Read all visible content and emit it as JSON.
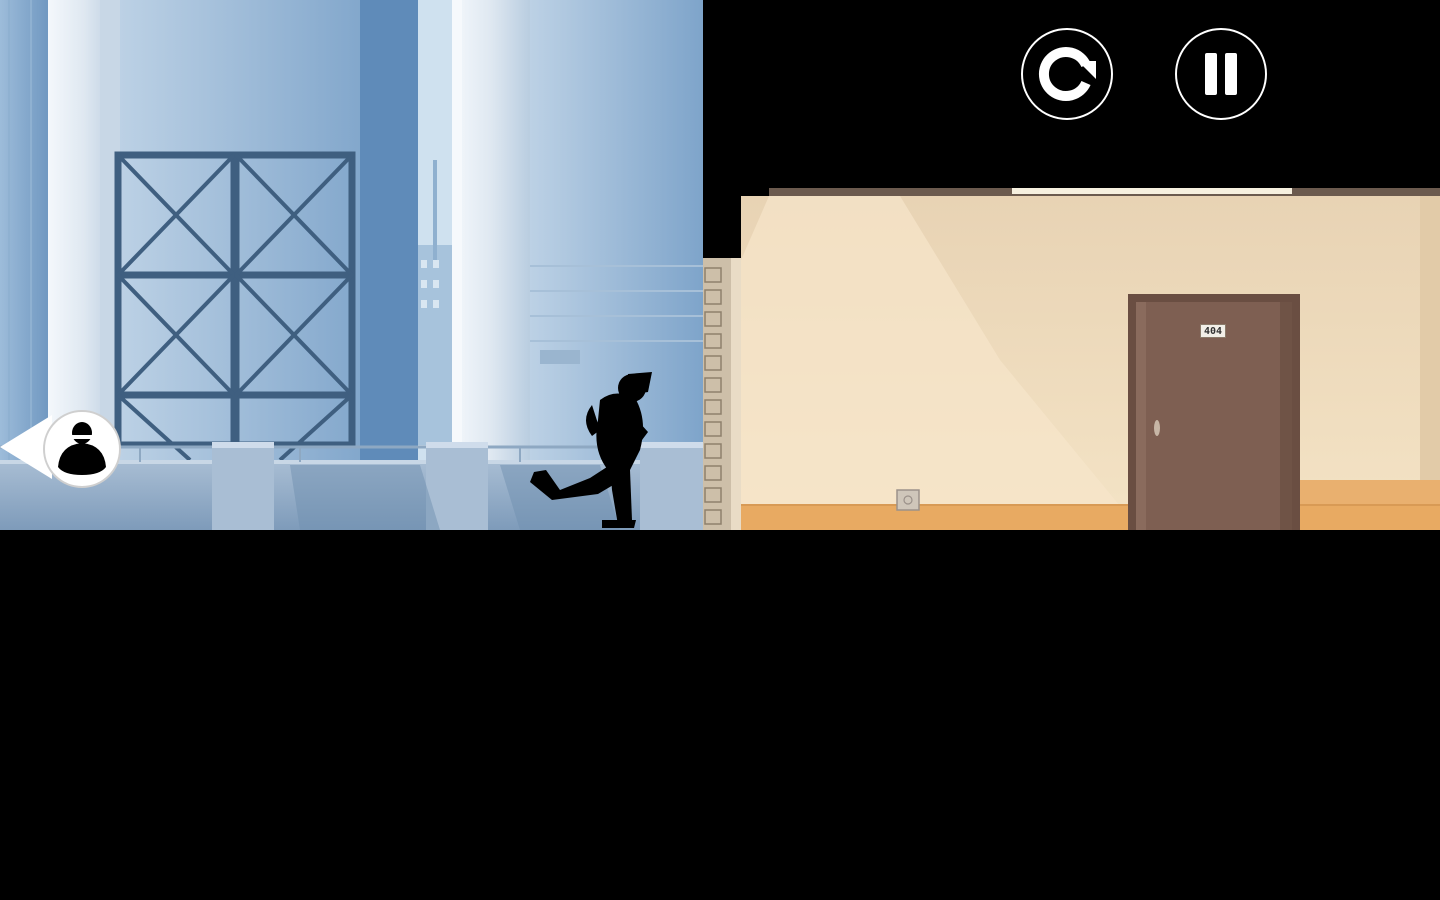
{
  "hud": {
    "restart_icon": "restart-icon",
    "pause_icon": "pause-icon"
  },
  "scene": {
    "door_number": "404"
  },
  "colors": {
    "sky_light": "#d8e8f4",
    "sky_mid": "#a8c6e0",
    "building_blue": "#7fa3c8",
    "scaffold": "#3f5f80",
    "wall_cream": "#f1dfc0",
    "floor_orange": "#e8aa62",
    "door_brown": "#7e5f52",
    "silhouette": "#000000",
    "hud_border": "#ffffff"
  }
}
